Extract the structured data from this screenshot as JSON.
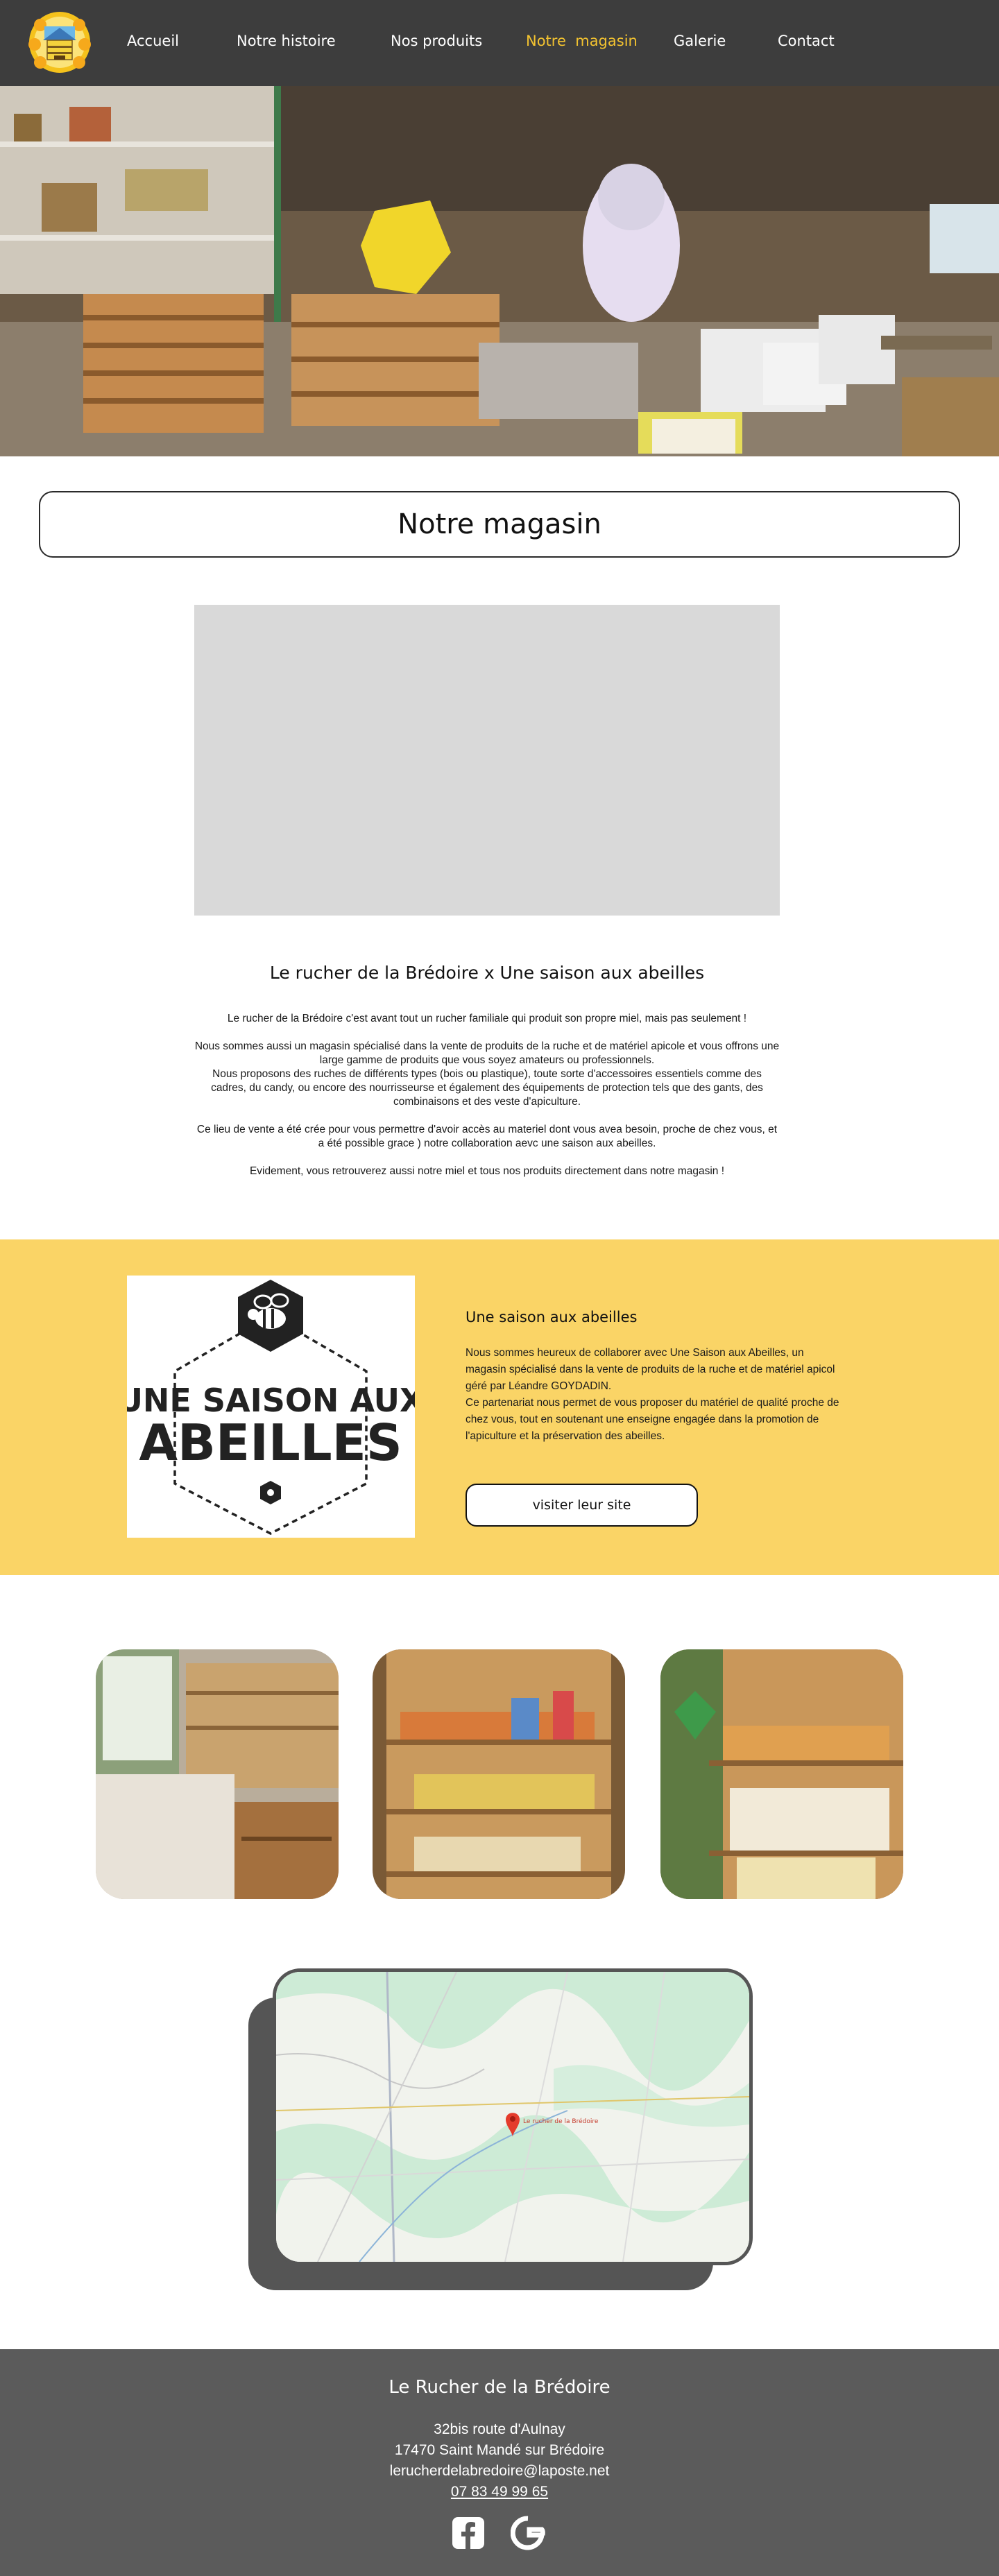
{
  "nav": {
    "items": [
      {
        "label": "Accueil",
        "active": false
      },
      {
        "label": "Notre histoire",
        "active": false
      },
      {
        "label": "Nos produits",
        "active": false
      },
      {
        "label": "Notre  magasin",
        "active": true
      },
      {
        "label": "Galerie",
        "active": false
      },
      {
        "label": "Contact",
        "active": false
      }
    ],
    "active_color": "#f2c230"
  },
  "page": {
    "title": "Notre magasin"
  },
  "intro": {
    "heading": "Le rucher de la Brédoire x Une saison aux abeilles",
    "paragraphs": [
      "Le rucher de la Brédoire c'est avant tout un rucher familiale qui produit son propre miel, mais pas seulement !",
      "Nous sommes aussi un magasin spécialisé dans la vente de produits de la ruche et de matériel apicole et vous offrons une large gamme de produits que vous soyez amateurs ou professionnels.\nNous proposons des ruches de différents types (bois ou plastique), toute sorte d'accessoires essentiels comme des cadres, du candy, ou encore des nourrisseurse et également des équipements de protection tels que des gants, des combinaisons et des veste d'apiculture.",
      "Ce lieu de vente a été crée pour vous permettre d'avoir accès au materiel dont vous avea besoin, proche de chez vous, et a été possible grace ) notre collaboration aevc une saison aux abeilles.",
      "Evidement, vous retrouverez aussi notre miel et tous nos produits directement dans notre magasin !"
    ]
  },
  "partner": {
    "logo_text_top": "UNE SAISON AUX",
    "logo_text_bottom": "ABEILLES",
    "heading": "Une saison aux abeilles",
    "text": "Nous sommes heureux de collaborer avec Une Saison aux Abeilles, un magasin spécialisé dans la vente de produits de la ruche et de matériel apicol géré par Léandre GOYDADIN.\nCe partenariat nous permet de vous proposer du matériel de qualité proche de chez vous, tout en soutenant une enseigne engagée dans la promotion de l'apiculture et la préservation des abeilles.",
    "button_label": "visiter leur site",
    "band_color": "#fad466"
  },
  "map": {
    "marker_label": "Le rucher de la Brédoire"
  },
  "footer": {
    "title": "Le Rucher de la Brédoire",
    "address_line1": "32bis route d'Aulnay",
    "address_line2": "17470 Saint Mandé sur Brédoire",
    "email": "lerucherdelabredoire@laposte.net",
    "phone": "07 83 49 99 65",
    "social": [
      {
        "icon": "facebook-icon"
      },
      {
        "icon": "google-icon"
      }
    ]
  }
}
